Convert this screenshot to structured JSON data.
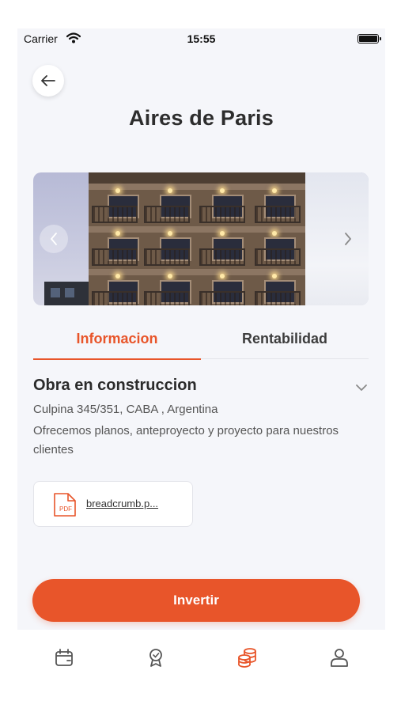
{
  "status_bar": {
    "carrier": "Carrier",
    "time": "15:55"
  },
  "header": {
    "title": "Aires de Paris"
  },
  "tabs": [
    {
      "label": "Informacion",
      "active": true
    },
    {
      "label": "Rentabilidad",
      "active": false
    }
  ],
  "section": {
    "title": "Obra en construccion",
    "address": "Culpina 345/351, CABA , Argentina",
    "description": "Ofrecemos planos, anteproyecto y proyecto para nuestros clientes"
  },
  "attachment": {
    "file_name": "breadcrumb.p...",
    "icon_label": "PDF"
  },
  "actions": {
    "invest_label": "Invertir"
  },
  "tabbar": {
    "items": [
      {
        "icon": "calendar-icon",
        "active": false
      },
      {
        "icon": "ribbon-icon",
        "active": false
      },
      {
        "icon": "coins-icon",
        "active": true
      },
      {
        "icon": "user-icon",
        "active": false
      }
    ]
  },
  "colors": {
    "accent": "#e8552a",
    "background": "#f5f6fa",
    "text": "#2b2b2b"
  }
}
